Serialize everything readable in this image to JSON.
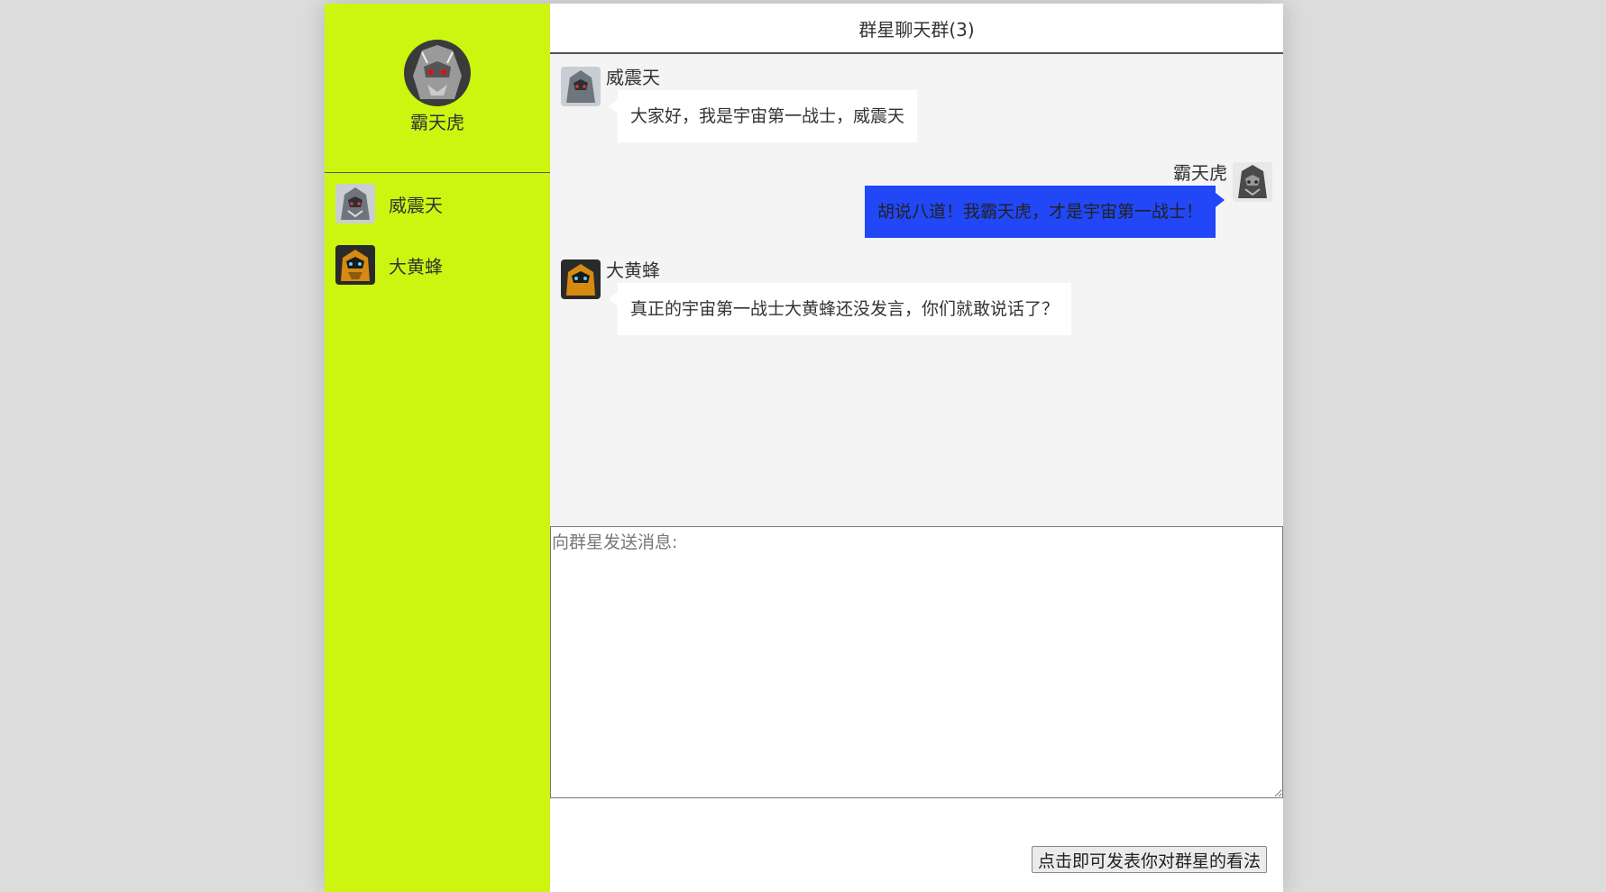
{
  "profile": {
    "name": "霸天虎",
    "avatar_icon": "robot-face-icon"
  },
  "contacts": [
    {
      "name": "威震天",
      "avatar_icon": "megatron-avatar-icon"
    },
    {
      "name": "大黄蜂",
      "avatar_icon": "bumblebee-avatar-icon"
    }
  ],
  "chat": {
    "title": "群星聊天群(3)",
    "messages": [
      {
        "side": "left",
        "sender": "威震天",
        "text": "大家好，我是宇宙第一战士，威震天"
      },
      {
        "side": "right",
        "sender": "霸天虎",
        "text": "胡说八道！我霸天虎，才是宇宙第一战士！"
      },
      {
        "side": "left",
        "sender": "大黄蜂",
        "text": "真正的宇宙第一战士大黄蜂还没发言，你们就敢说话了？"
      }
    ]
  },
  "composer": {
    "placeholder": "向群星发送消息:",
    "value": ""
  },
  "send_button": {
    "label": "点击即可发表你对群星的看法"
  },
  "colors": {
    "sidebar": "#ccf60f",
    "own_bubble": "#2147f6",
    "chat_background": "#f4f4f4",
    "page_background": "#dcdcdc"
  }
}
